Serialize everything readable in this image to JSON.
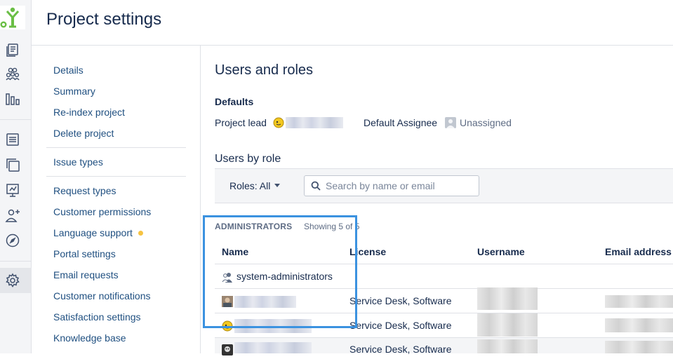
{
  "header": {
    "title": "Project settings"
  },
  "rail": {
    "icons": [
      "app-logo-icon",
      "board-icon",
      "people-icon",
      "reports-icon",
      "queues-icon",
      "pages-icon",
      "presentation-icon",
      "add-person-icon",
      "compass-icon",
      "gear-icon"
    ]
  },
  "nav": {
    "items": [
      {
        "label": "Details"
      },
      {
        "label": "Summary"
      },
      {
        "label": "Re-index project"
      },
      {
        "label": "Delete project"
      },
      {
        "label": "Issue types"
      },
      {
        "label": "Request types"
      },
      {
        "label": "Customer permissions"
      },
      {
        "label": "Language support"
      },
      {
        "label": "Portal settings"
      },
      {
        "label": "Email requests"
      },
      {
        "label": "Customer notifications"
      },
      {
        "label": "Satisfaction settings"
      },
      {
        "label": "Knowledge base"
      }
    ]
  },
  "main": {
    "title": "Users and roles",
    "defaults": {
      "heading": "Defaults",
      "project_lead_label": "Project lead",
      "default_assignee_label": "Default Assignee",
      "default_assignee_value": "Unassigned"
    },
    "users_by_role": {
      "heading": "Users by role",
      "roles_filter": "Roles: All",
      "search_placeholder": "Search by name or email"
    },
    "administrators": {
      "title": "ADMINISTRATORS",
      "showing": "Showing 5 of 5",
      "columns": [
        "Name",
        "License",
        "Username",
        "Email address"
      ],
      "rows": [
        {
          "name": "system-administrators",
          "license": ""
        },
        {
          "name": "",
          "license": "Service Desk, Software"
        },
        {
          "name": "",
          "license": "Service Desk, Software"
        },
        {
          "name": "",
          "license": "Service Desk, Software"
        }
      ]
    }
  },
  "colors": {
    "link": "#205081",
    "highlight": "#3b92e0",
    "status_dot": "#f6c342"
  }
}
